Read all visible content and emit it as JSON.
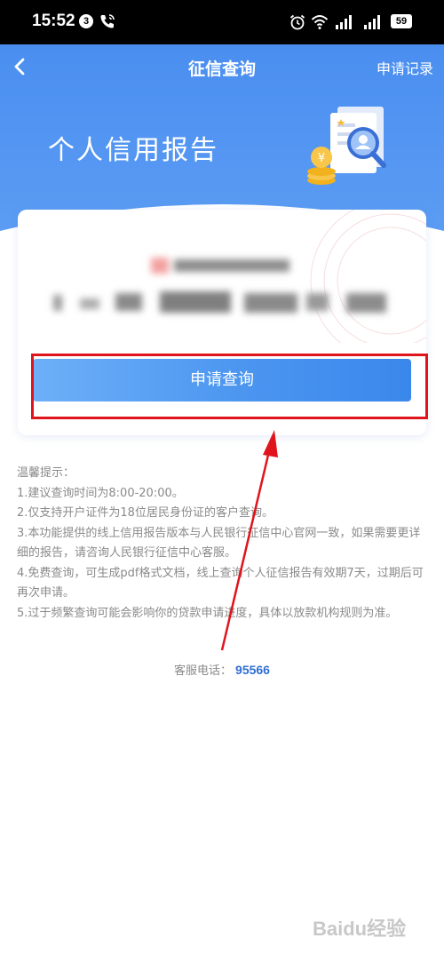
{
  "status_bar": {
    "time": "15:52",
    "notification_count": "3",
    "battery": "59"
  },
  "nav": {
    "title": "征信查询",
    "right_link": "申请记录"
  },
  "hero": {
    "title": "个人信用报告"
  },
  "card": {
    "apply_button": "申请查询"
  },
  "tips": {
    "heading": "温馨提示：",
    "items": [
      "1.建议查询时间为8:00-20:00。",
      "2.仅支持开户证件为18位居民身份证的客户查询。",
      "3.本功能提供的线上信用报告版本与人民银行征信中心官网一致，如果需要更详细的报告，请咨询人民银行征信中心客服。",
      "4.免费查询，可生成pdf格式文档，线上查询个人征信报告有效期7天，过期后可再次申请。",
      "5.过于频繁查询可能会影响你的贷款申请进度，具体以放款机构规则为准。"
    ]
  },
  "service": {
    "label": "客服电话：",
    "phone": "95566"
  },
  "watermark": {
    "text": "Baidu经验"
  },
  "colors": {
    "header_blue": "#4a8ef0",
    "button_blue": "#4c96f0",
    "annotation_red": "#e0141c",
    "phone_link": "#2f6ed6"
  }
}
